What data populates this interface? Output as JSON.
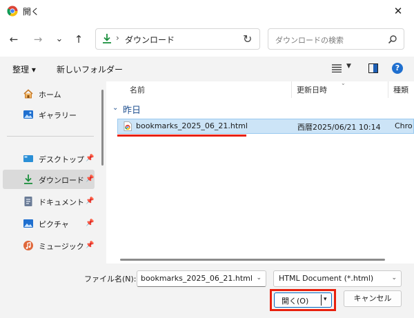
{
  "window": {
    "title": "開く",
    "close_glyph": "✕"
  },
  "nav": {
    "back": "←",
    "forward": "→",
    "recent": "⌄",
    "up": "↑",
    "breadcrumb_sep": "›",
    "location": "ダウンロード",
    "refresh": "↻",
    "search_placeholder": "ダウンロードの検索"
  },
  "toolbar": {
    "organize": "整理 ▾",
    "new_folder": "新しいフォルダー",
    "view_dropdown": "▼",
    "help": "?"
  },
  "sidebar": {
    "pin_glyph": "📌",
    "items": [
      {
        "label": "ホーム",
        "icon": "home-icon",
        "pinned": false,
        "selected": false
      },
      {
        "label": "ギャラリー",
        "icon": "gallery-icon",
        "pinned": false,
        "selected": false
      },
      {
        "label": "デスクトップ",
        "icon": "desktop-icon",
        "pinned": true,
        "selected": false
      },
      {
        "label": "ダウンロード",
        "icon": "download-icon",
        "pinned": true,
        "selected": true
      },
      {
        "label": "ドキュメント",
        "icon": "document-icon",
        "pinned": true,
        "selected": false
      },
      {
        "label": "ピクチャ",
        "icon": "pictures-icon",
        "pinned": true,
        "selected": false
      },
      {
        "label": "ミュージック",
        "icon": "music-icon",
        "pinned": true,
        "selected": false
      }
    ]
  },
  "files": {
    "columns": {
      "name": "名前",
      "modified": "更新日時",
      "type": "種類"
    },
    "group": "昨日",
    "group_chevron": "⌄",
    "rows": [
      {
        "name": "bookmarks_2025_06_21.html",
        "modified": "西暦2025/06/21 10:14",
        "type": "Chro"
      }
    ]
  },
  "footer": {
    "filename_label": "ファイル名(N):",
    "filename_value": "bookmarks_2025_06_21.html",
    "filter_value": "HTML Document (*.html)",
    "dropdown_glyph": "⌄",
    "open_label": "開く(O)",
    "open_split_glyph": "▾",
    "cancel_label": "キャンセル"
  },
  "colors": {
    "accent": "#0067c0",
    "selection": "#cce4f7",
    "highlight_annotation": "#e8200d"
  }
}
